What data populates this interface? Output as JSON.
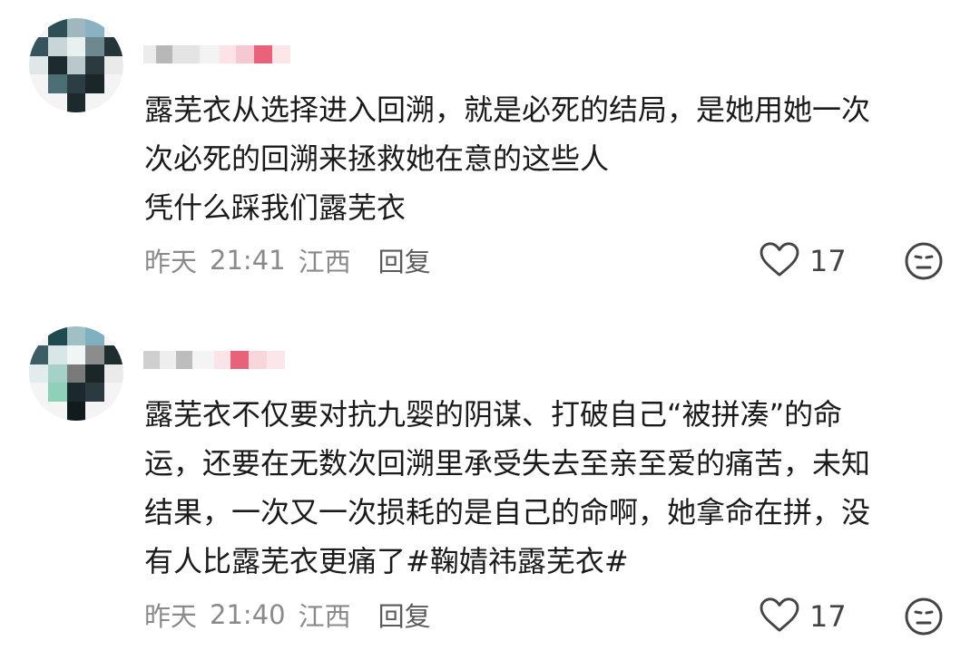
{
  "comments": [
    {
      "lines": [
        "露芜衣从选择进入回溯，就是必死的结局，是她用她一次",
        "次必死的回溯来拯救她在意的这些人",
        "凭什么踩我们露芜衣"
      ],
      "date": "昨天",
      "time": "21:41",
      "location": "江西",
      "reply_label": "回复",
      "likes": "17"
    },
    {
      "lines": [
        "露芜衣不仅要对抗九婴的阴谋、打破自己“被拼凑”的命",
        "运，还要在无数次回溯里承受失去至亲至爱的痛苦，未知",
        "结果，一次又一次损耗的是自己的命啊，她拿命在拼，没",
        "有人比露芜衣更痛了#鞠婧祎露芜衣#"
      ],
      "date": "昨天",
      "time": "21:40",
      "location": "江西",
      "reply_label": "回复",
      "likes": "17"
    }
  ],
  "icons": {
    "like": "heart-outline-icon",
    "emoji": "neutral-face-icon"
  },
  "colors": {
    "text": "#1a1a1a",
    "meta": "#8a8a8a",
    "username_accent": "#e8627a"
  }
}
